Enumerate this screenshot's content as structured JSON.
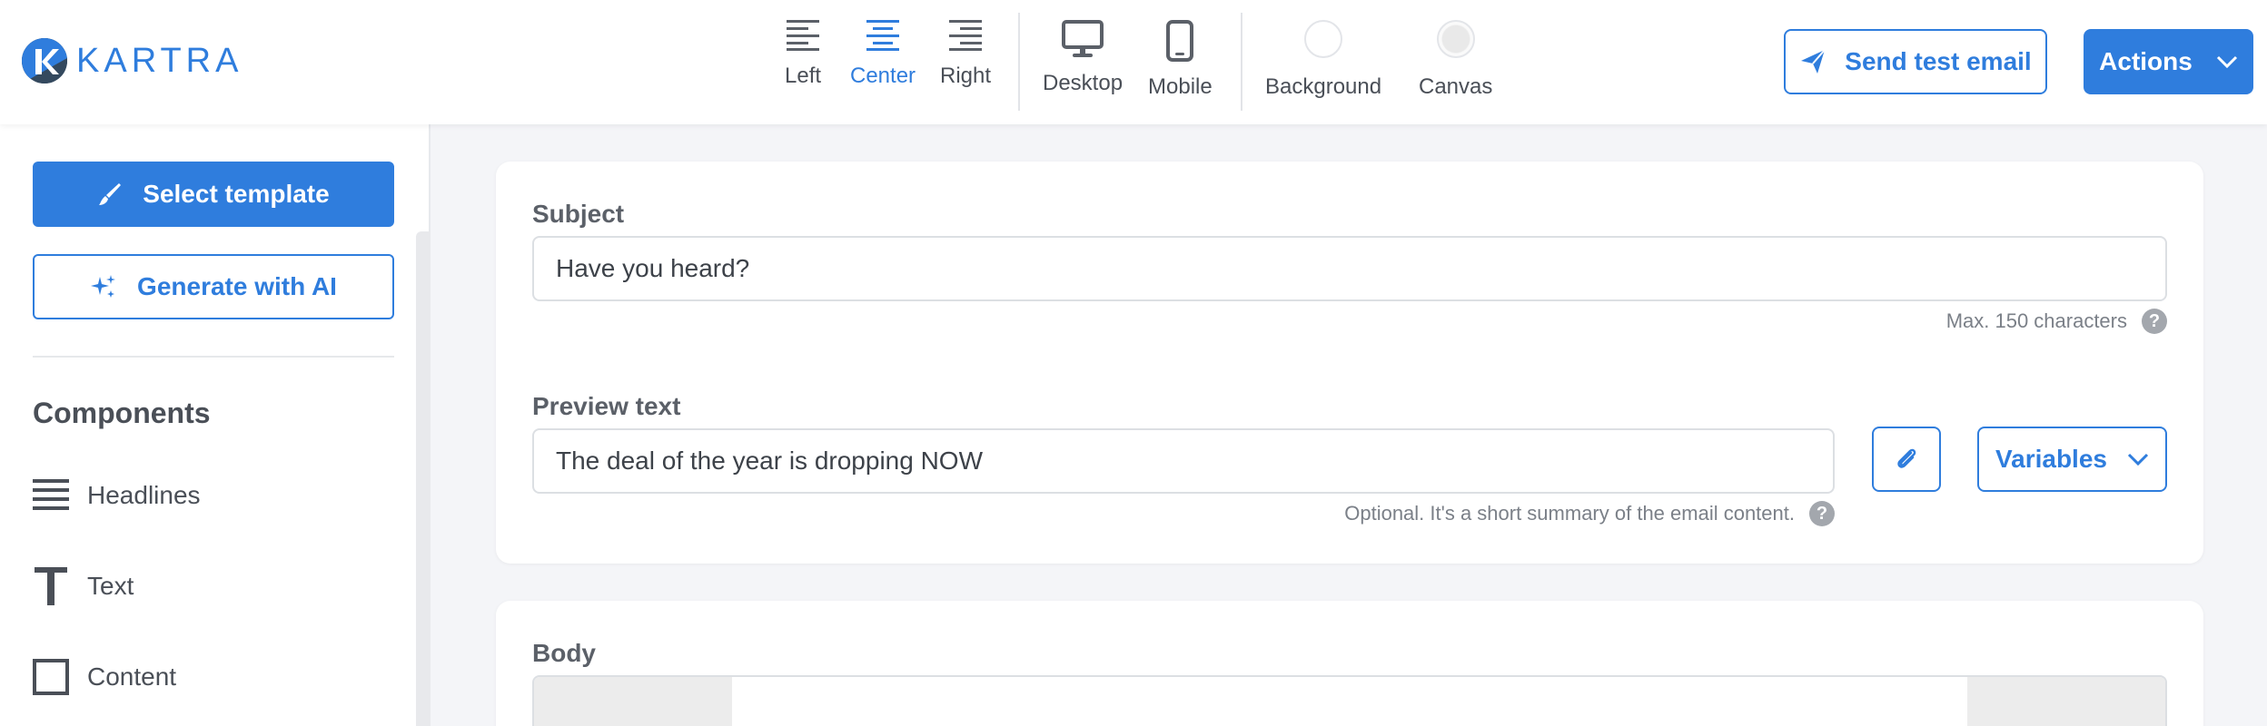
{
  "brand": {
    "logo_text": "KARTRA",
    "accent": "#2f7ddd",
    "logo_dark": "#34495e"
  },
  "toolbar": {
    "align": [
      {
        "label": "Left",
        "icon": "align-left-icon",
        "active": false
      },
      {
        "label": "Center",
        "icon": "align-center-icon",
        "active": true
      },
      {
        "label": "Right",
        "icon": "align-right-icon",
        "active": false
      }
    ],
    "device": [
      {
        "label": "Desktop",
        "icon": "desktop-icon"
      },
      {
        "label": "Mobile",
        "icon": "mobile-icon"
      }
    ],
    "colors": [
      {
        "label": "Background"
      },
      {
        "label": "Canvas"
      }
    ],
    "send_test_label": "Send test email",
    "actions_label": "Actions"
  },
  "sidebar": {
    "select_template_label": "Select template",
    "generate_ai_label": "Generate with AI",
    "components_title": "Components",
    "components": [
      {
        "label": "Headlines",
        "icon": "headlines-icon"
      },
      {
        "label": "Text",
        "icon": "text-icon"
      },
      {
        "label": "Content",
        "icon": "content-box-icon"
      }
    ]
  },
  "email": {
    "subject_label": "Subject",
    "subject_value": "Have you heard?",
    "subject_hint": "Max. 150 characters",
    "preview_label": "Preview text",
    "preview_value": "The deal of the year is dropping NOW",
    "preview_hint": "Optional. It's a short summary of the email content.",
    "variables_label": "Variables",
    "body_label": "Body",
    "help_glyph": "?"
  }
}
